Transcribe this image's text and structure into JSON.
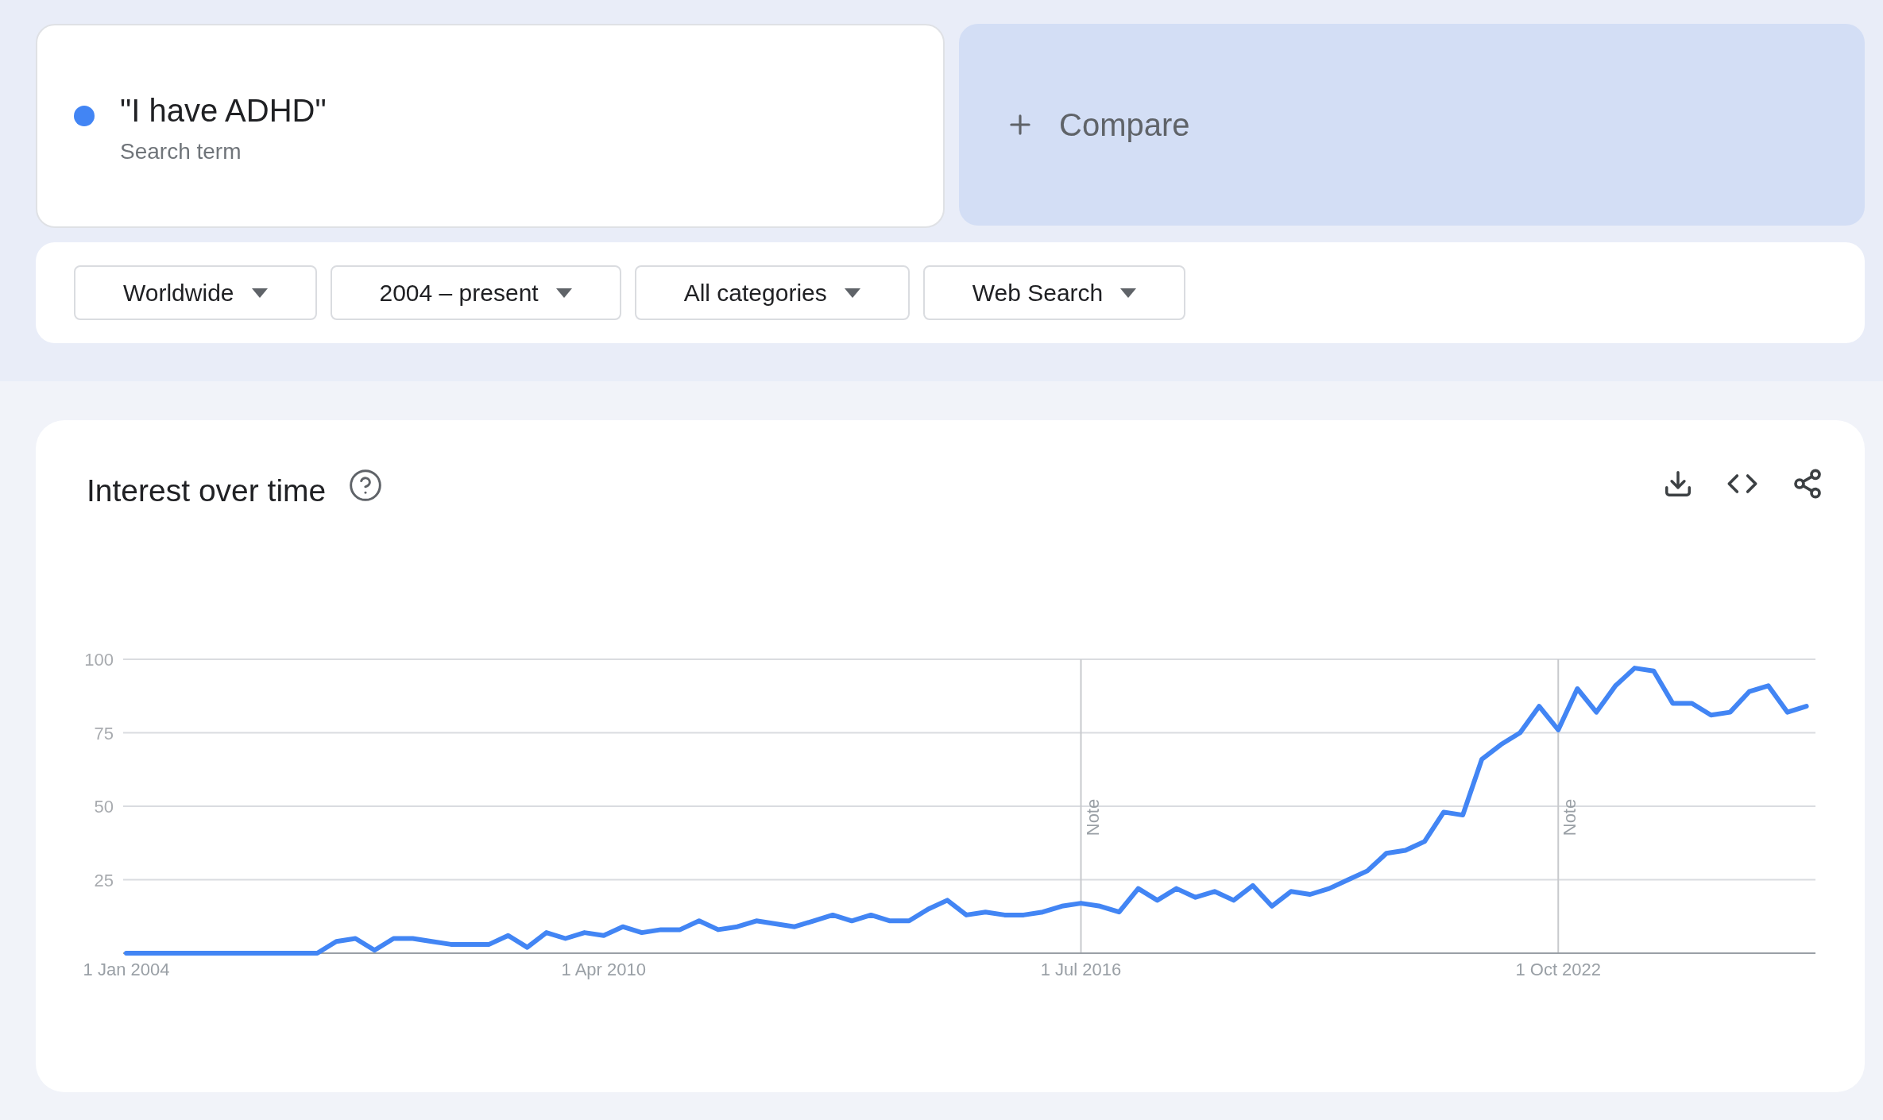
{
  "search_term": {
    "color": "#4285f4",
    "term": "\"I have ADHD\"",
    "subtitle": "Search term"
  },
  "compare": {
    "label": "Compare"
  },
  "filters": [
    {
      "label": "Worldwide"
    },
    {
      "label": "2004 – present"
    },
    {
      "label": "All categories"
    },
    {
      "label": "Web Search"
    }
  ],
  "interest_card": {
    "title": "Interest over time",
    "chart_data": {
      "type": "line",
      "ylim": [
        0,
        100
      ],
      "categories": [
        "1 Jan 2004",
        null,
        null,
        null,
        null,
        null,
        null,
        null,
        null,
        null,
        null,
        null,
        null,
        null,
        null,
        null,
        null,
        null,
        null,
        null,
        null,
        null,
        null,
        null,
        null,
        "1 Apr 2010",
        null,
        null,
        null,
        null,
        null,
        null,
        null,
        null,
        null,
        null,
        null,
        null,
        null,
        null,
        null,
        null,
        null,
        null,
        null,
        null,
        null,
        null,
        null,
        null,
        "1 Jul 2016",
        null,
        null,
        null,
        null,
        null,
        null,
        null,
        null,
        null,
        null,
        null,
        null,
        null,
        null,
        null,
        null,
        null,
        null,
        null,
        null,
        null,
        null,
        null,
        null,
        "1 Oct 2022",
        null,
        null,
        null,
        null,
        null,
        null,
        null,
        null,
        null,
        null,
        null,
        null,
        null
      ],
      "series": [
        {
          "color": "#4285f4",
          "values": [
            0,
            0,
            0,
            0,
            0,
            0,
            0,
            0,
            0,
            0,
            0,
            4,
            5,
            1,
            5,
            5,
            4,
            3,
            3,
            3,
            6,
            2,
            7,
            5,
            7,
            6,
            9,
            7,
            8,
            8,
            11,
            8,
            9,
            11,
            10,
            9,
            11,
            13,
            11,
            13,
            11,
            11,
            15,
            18,
            13,
            14,
            13,
            13,
            14,
            16,
            17,
            16,
            14,
            22,
            18,
            22,
            19,
            21,
            18,
            23,
            16,
            21,
            20,
            22,
            25,
            28,
            34,
            35,
            38,
            48,
            47,
            66,
            71,
            75,
            84,
            76,
            90,
            82,
            91,
            97,
            96,
            85,
            85,
            81,
            82,
            89,
            91,
            82,
            84
          ]
        }
      ],
      "yticks": [
        25,
        50,
        75,
        100
      ],
      "grid": true,
      "annotations": [
        "Note",
        "Note"
      ]
    }
  }
}
